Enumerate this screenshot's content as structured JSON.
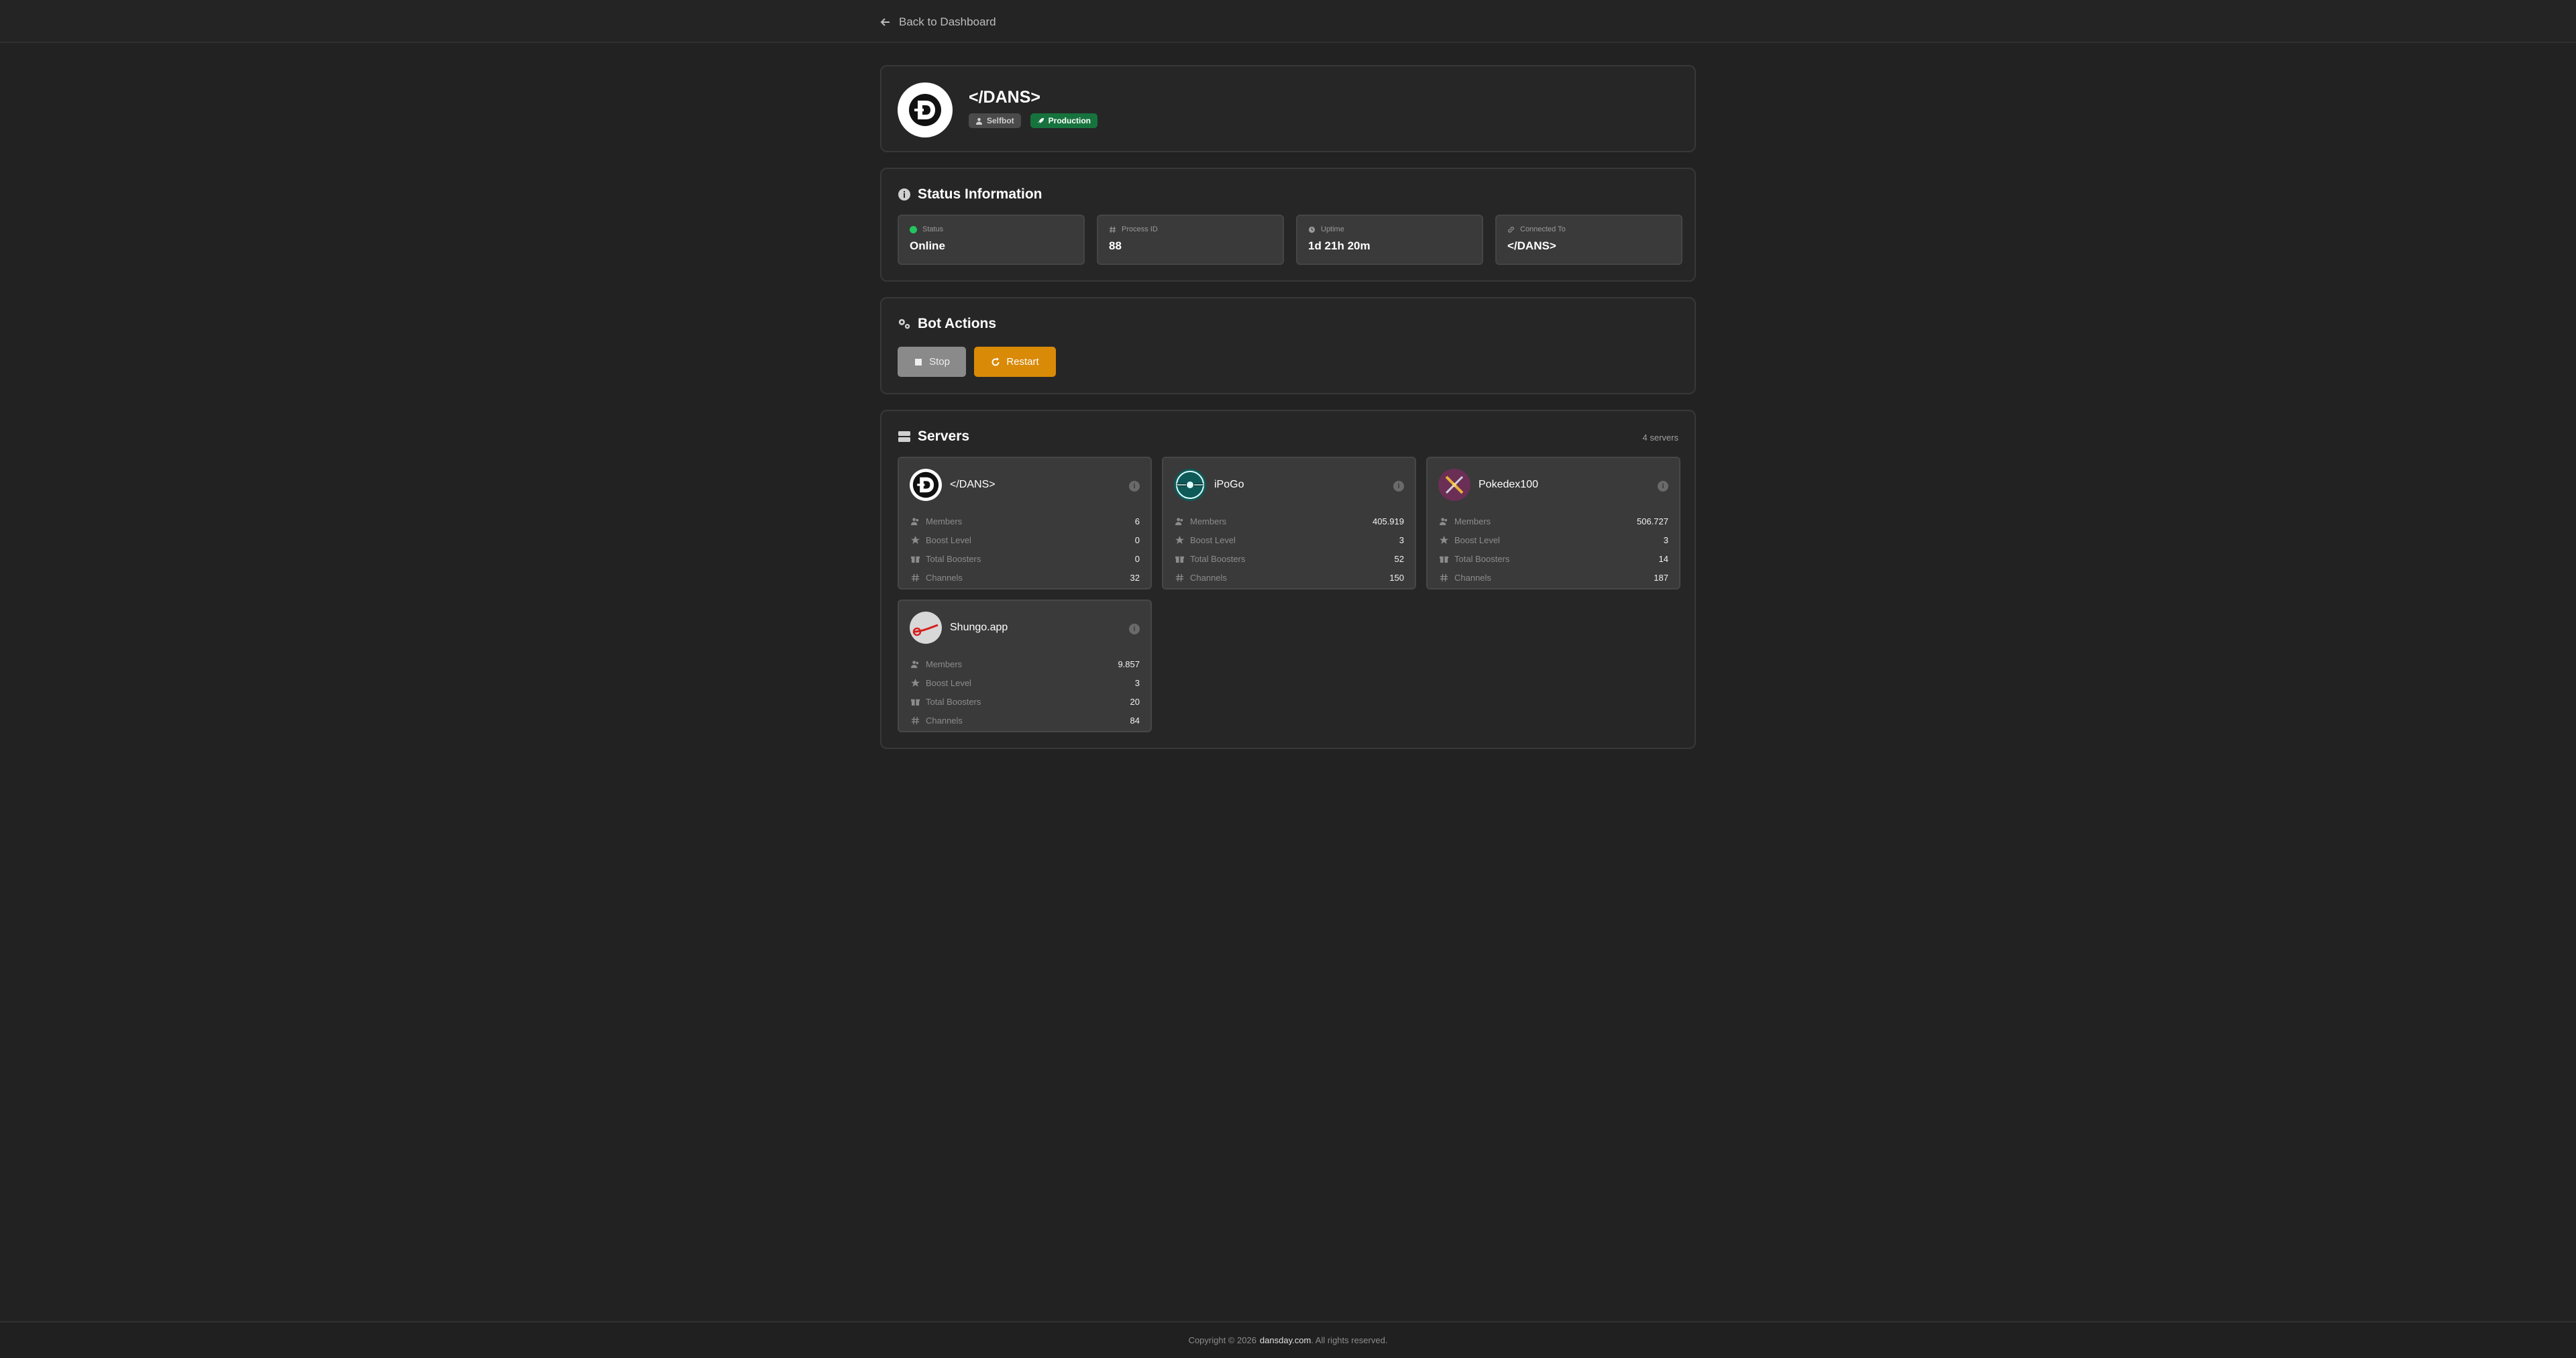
{
  "nav": {
    "back_label": "Back to Dashboard"
  },
  "bot": {
    "name": "</DANS>",
    "badges": {
      "selfbot": "Selfbot",
      "production": "Production"
    }
  },
  "status": {
    "title": "Status Information",
    "items": [
      {
        "label": "Status",
        "value": "Online"
      },
      {
        "label": "Process ID",
        "value": "88"
      },
      {
        "label": "Uptime",
        "value": "1d 21h 20m"
      },
      {
        "label": "Connected To",
        "value": "</DANS>"
      }
    ]
  },
  "actions": {
    "title": "Bot Actions",
    "stop_label": "Stop",
    "restart_label": "Restart"
  },
  "servers": {
    "title": "Servers",
    "count_label": "4 servers",
    "metric_labels": {
      "members": "Members",
      "boost_level": "Boost Level",
      "total_boosters": "Total Boosters",
      "channels": "Channels"
    },
    "items": [
      {
        "name": "</DANS>",
        "members": "6",
        "boost_level": "0",
        "total_boosters": "0",
        "channels": "32"
      },
      {
        "name": "iPoGo",
        "members": "405.919",
        "boost_level": "3",
        "total_boosters": "52",
        "channels": "150"
      },
      {
        "name": "Pokedex100",
        "members": "506.727",
        "boost_level": "3",
        "total_boosters": "14",
        "channels": "187"
      },
      {
        "name": "Shungo.app",
        "members": "9.857",
        "boost_level": "3",
        "total_boosters": "20",
        "channels": "84"
      }
    ]
  },
  "footer": {
    "prefix": "Copyright © 2026",
    "site": "dansday.com",
    "suffix": ". All rights reserved."
  },
  "colors": {
    "background": "#222222",
    "online": "#22c55e",
    "production": "#16733d",
    "restart": "#d98a07",
    "stop": "#8a8a8a"
  }
}
